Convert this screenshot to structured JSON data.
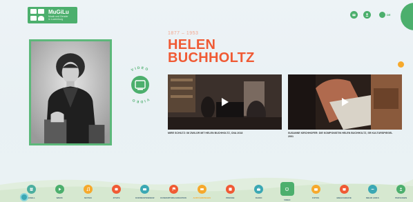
{
  "logo": {
    "title": "MuGiLu",
    "subtitle_line1": "Musik und Gender",
    "subtitle_line2": "in Luxemburg"
  },
  "header": {
    "icons": [
      "contact-icon",
      "account-icon"
    ],
    "language": "DE"
  },
  "person": {
    "years": "1877 – 1953",
    "first_name": "HELEN",
    "last_name": "BUCHHOLTZ"
  },
  "video_badge": {
    "label": "VIDEO"
  },
  "videos": [
    {
      "caption": "MIRE SCHILTZ: IM ZWILOR MIT HELEN BUCHHOLTZ, CNA 2018"
    },
    {
      "caption": "SUSANNE KIRCHHOFER: DIE KOMPONISTIN HELEN BUCHHOLTZ, SR KULTURSPIEGEL 2001"
    }
  ],
  "nav": [
    {
      "label": "GESELL",
      "color": "#4caf9f",
      "icon": "people-icon"
    },
    {
      "label": "WERK",
      "color": "#4caf6d",
      "icon": "play-icon"
    },
    {
      "label": "NOTEN",
      "color": "#f6a92c",
      "icon": "note-icon"
    },
    {
      "label": "ZITATE",
      "color": "#f05a34",
      "icon": "quote-icon"
    },
    {
      "label": "KORRESPONDENZ",
      "color": "#3ba8b4",
      "icon": "mail-icon"
    },
    {
      "label": "KONZERTORGANISATION",
      "color": "#f05a34",
      "icon": "flag-icon"
    },
    {
      "label": "AUFFÜHRUNGEN",
      "color": "#f6a92c",
      "icon": "ticket-icon",
      "highlight": true
    },
    {
      "label": "PRESSE",
      "color": "#f05a34",
      "icon": "newspaper-icon"
    },
    {
      "label": "RADIO",
      "color": "#3ba8b4",
      "icon": "radio-icon"
    },
    {
      "label": "VIDEO",
      "color": "#4caf6d",
      "icon": "tv-icon",
      "active": true
    },
    {
      "label": "FOTOS",
      "color": "#f6a92c",
      "icon": "camera-icon"
    },
    {
      "label": "BIBLIOGRAFIE",
      "color": "#f05a34",
      "icon": "book-icon"
    },
    {
      "label": "MEHR LINKS",
      "color": "#3ba8b4",
      "icon": "dots-icon"
    },
    {
      "label": "PERSONEN",
      "color": "#4caf6d",
      "icon": "person-icon"
    }
  ]
}
